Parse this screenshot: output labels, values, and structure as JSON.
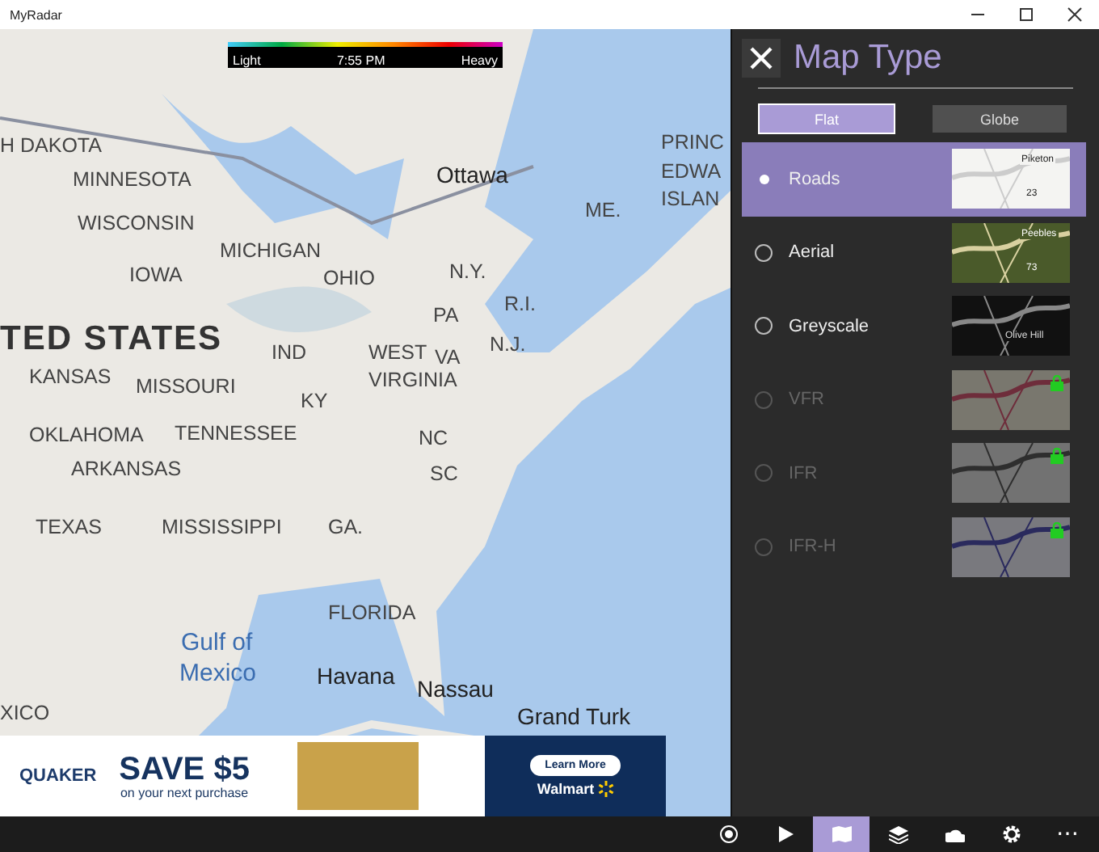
{
  "window": {
    "title": "MyRadar"
  },
  "legend": {
    "low": "Light",
    "time": "7:55 PM",
    "high": "Heavy"
  },
  "map_labels": [
    {
      "text": "H DAKOTA",
      "kind": "region"
    },
    {
      "text": "MINNESOTA",
      "kind": "region"
    },
    {
      "text": "WISCONSIN",
      "kind": "region"
    },
    {
      "text": "MICHIGAN",
      "kind": "region"
    },
    {
      "text": "IOWA",
      "kind": "region"
    },
    {
      "text": "OHIO",
      "kind": "region"
    },
    {
      "text": "PA",
      "kind": "region"
    },
    {
      "text": "N.Y.",
      "kind": "region"
    },
    {
      "text": "ME.",
      "kind": "region"
    },
    {
      "text": "Ottawa",
      "kind": "city"
    },
    {
      "text": "PRINC",
      "kind": "region"
    },
    {
      "text": "EDWA",
      "kind": "region"
    },
    {
      "text": "ISLAN",
      "kind": "region"
    },
    {
      "text": "TED STATES",
      "kind": "country"
    },
    {
      "text": "KANSAS",
      "kind": "region"
    },
    {
      "text": "MISSOURI",
      "kind": "region"
    },
    {
      "text": "IND",
      "kind": "region"
    },
    {
      "text": "WEST",
      "kind": "region"
    },
    {
      "text": "VIRGINIA",
      "kind": "region"
    },
    {
      "text": "KY",
      "kind": "region"
    },
    {
      "text": "VA",
      "kind": "region"
    },
    {
      "text": "N.J.",
      "kind": "region"
    },
    {
      "text": "R.I.",
      "kind": "region"
    },
    {
      "text": "OKLAHOMA",
      "kind": "region"
    },
    {
      "text": "TENNESSEE",
      "kind": "region"
    },
    {
      "text": "NC",
      "kind": "region"
    },
    {
      "text": "ARKANSAS",
      "kind": "region"
    },
    {
      "text": "SC",
      "kind": "region"
    },
    {
      "text": "TEXAS",
      "kind": "region"
    },
    {
      "text": "MISSISSIPPI",
      "kind": "region"
    },
    {
      "text": "GA.",
      "kind": "region"
    },
    {
      "text": "FLORIDA",
      "kind": "region"
    },
    {
      "text": "Gulf of",
      "kind": "water"
    },
    {
      "text": "Mexico",
      "kind": "water"
    },
    {
      "text": "Havana",
      "kind": "city"
    },
    {
      "text": "Nassau",
      "kind": "city"
    },
    {
      "text": "Grand Turk",
      "kind": "city"
    },
    {
      "text": "XICO",
      "kind": "region"
    }
  ],
  "ad": {
    "brand": "QUAKER",
    "headline": "SAVE $5",
    "subline": "on your next purchase",
    "button": "Learn More",
    "store": "Walmart"
  },
  "panel": {
    "title": "Map Type",
    "views": [
      {
        "label": "Flat",
        "selected": true
      },
      {
        "label": "Globe",
        "selected": false
      }
    ],
    "map_types": [
      {
        "name": "Roads",
        "selected": true,
        "locked": false,
        "kind": "roads",
        "thumb_labels": [
          "Piketon",
          "23"
        ]
      },
      {
        "name": "Aerial",
        "selected": false,
        "locked": false,
        "kind": "aerial",
        "thumb_labels": [
          "Peebles",
          "73"
        ]
      },
      {
        "name": "Greyscale",
        "selected": false,
        "locked": false,
        "kind": "grey",
        "thumb_labels": [
          "Olive Hill"
        ]
      },
      {
        "name": "VFR",
        "selected": false,
        "locked": true,
        "kind": "vfr"
      },
      {
        "name": "IFR",
        "selected": false,
        "locked": true,
        "kind": "ifr"
      },
      {
        "name": "IFR-H",
        "selected": false,
        "locked": true,
        "kind": "ifrh"
      }
    ]
  },
  "toolbar": [
    {
      "kind": "locate",
      "selected": false
    },
    {
      "kind": "play",
      "selected": false
    },
    {
      "kind": "map",
      "selected": true
    },
    {
      "kind": "layers",
      "selected": false
    },
    {
      "kind": "cloud",
      "selected": false
    },
    {
      "kind": "settings",
      "selected": false
    },
    {
      "kind": "more",
      "label": "⋯",
      "selected": false
    }
  ]
}
